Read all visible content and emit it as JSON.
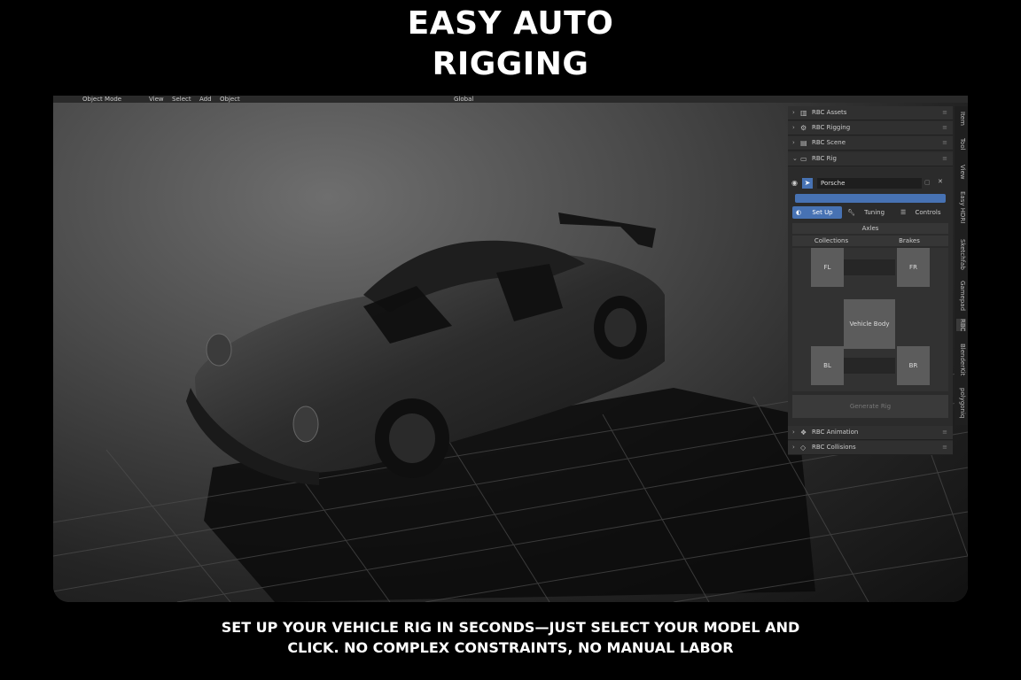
{
  "headline": {
    "line1": "EASY AUTO",
    "line2": "RIGGING"
  },
  "caption": {
    "line1": "SET UP YOUR VEHICLE RIG IN SECONDS—JUST SELECT YOUR MODEL AND",
    "line2": "CLICK. NO COMPLEX CONSTRAINTS, NO MANUAL LABOR"
  },
  "toolbar": {
    "mode": "Object Mode",
    "menu_view": "View",
    "menu_select": "Select",
    "menu_add": "Add",
    "menu_object": "Object",
    "transform": "Global"
  },
  "panels": {
    "assets": "RBC Assets",
    "rigging": "RBC Rigging",
    "scene": "RBC Scene",
    "rig": "RBC Rig",
    "animation": "RBC Animation",
    "collisions": "RBC Collisions"
  },
  "rig": {
    "object_name": "Porsche",
    "tabs": {
      "setup": "Set Up",
      "tuning": "Tuning",
      "controls": "Controls"
    },
    "axles_label": "Axles",
    "collections_label": "Collections",
    "brakes_label": "Brakes",
    "wheels": {
      "fl": "FL",
      "fr": "FR",
      "bl": "BL",
      "br": "BR"
    },
    "body_label": "Vehicle Body",
    "generate_label": "Generate Rig"
  },
  "side_tabs": [
    "Item",
    "Tool",
    "View",
    "Easy HDRI",
    "Sketchfab",
    "Gamepad",
    "RBC",
    "BlenderKit",
    "polygoniq"
  ]
}
